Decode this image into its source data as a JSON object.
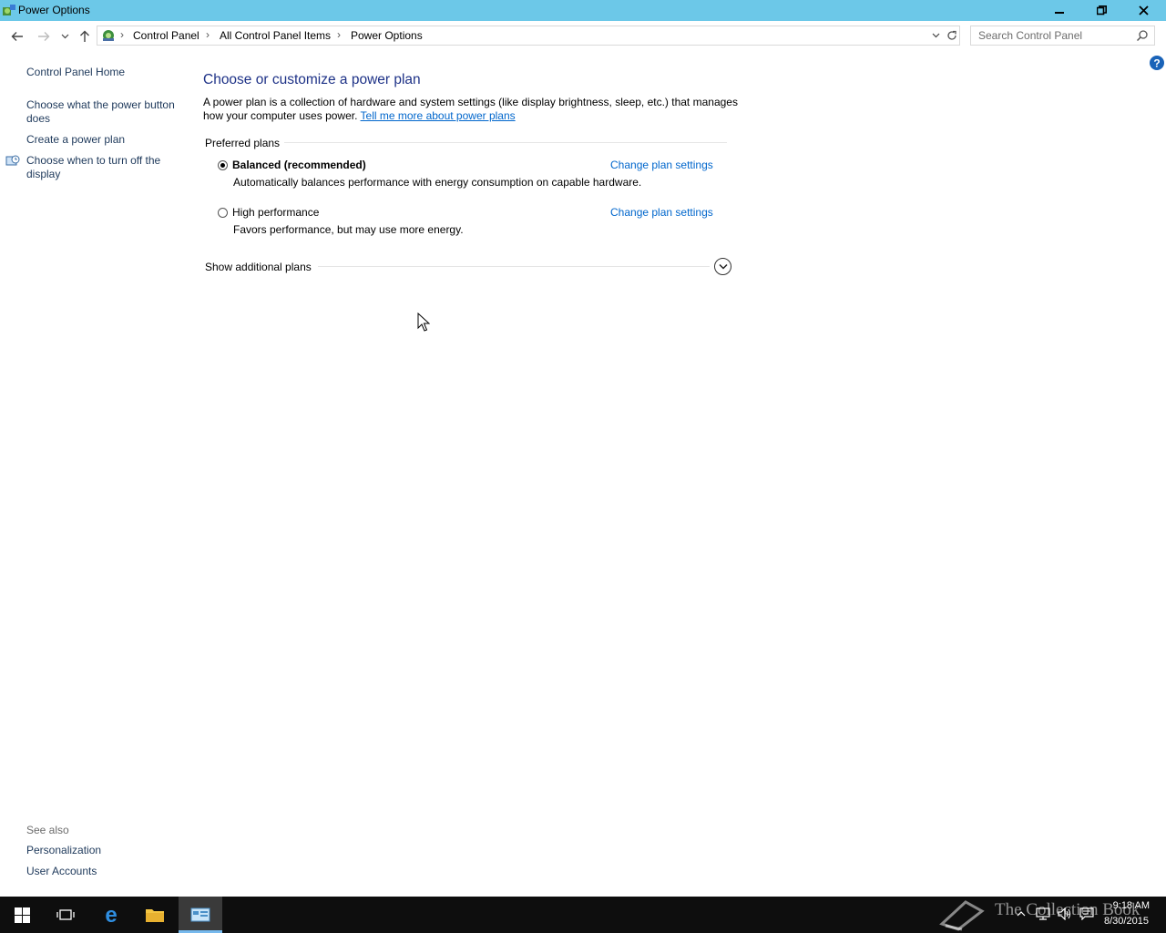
{
  "window": {
    "title": "Power Options"
  },
  "address": {
    "breadcrumbs": [
      "Control Panel",
      "All Control Panel Items",
      "Power Options"
    ],
    "search_placeholder": "Search Control Panel"
  },
  "left_nav": {
    "home": "Control Panel Home",
    "items": [
      "Choose what the power button does",
      "Create a power plan",
      "Choose when to turn off the display"
    ],
    "see_also_label": "See also",
    "see_also": [
      "Personalization",
      "User Accounts"
    ]
  },
  "main": {
    "heading": "Choose or customize a power plan",
    "description": "A power plan is a collection of hardware and system settings (like display brightness, sleep, etc.) that manages how your computer uses power.",
    "learn_more": "Tell me more about power plans",
    "preferred_label": "Preferred plans",
    "plans": [
      {
        "name": "Balanced (recommended)",
        "description": "Automatically balances performance with energy consumption on capable hardware.",
        "selected": true,
        "change_label": "Change plan settings"
      },
      {
        "name": "High performance",
        "description": "Favors performance, but may use more energy.",
        "selected": false,
        "change_label": "Change plan settings"
      }
    ],
    "show_additional": "Show additional plans"
  },
  "taskbar": {
    "time": "9:18 AM",
    "date": "8/30/2015",
    "watermark": "The Collection Book"
  },
  "colors": {
    "titlebar": "#6cc8e8",
    "link": "#0066cc",
    "heading": "#1e3287",
    "taskbar": "#0e0e0e"
  }
}
